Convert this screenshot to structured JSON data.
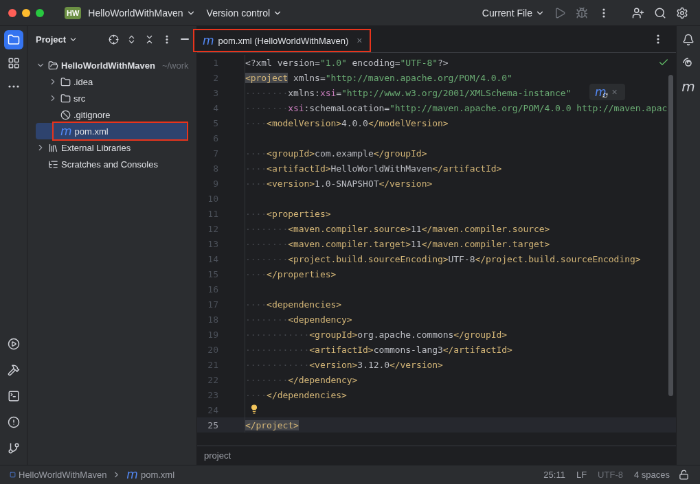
{
  "title_bar": {
    "project_badge": "HW",
    "project": "HelloWorldWithMaven",
    "vcs": "Version control",
    "run_config": "Current File",
    "actions": [
      {
        "kind": "run",
        "disabled": true
      },
      {
        "kind": "debug",
        "disabled": true
      },
      {
        "kind": "more",
        "disabled": false
      },
      {
        "kind": "add-user",
        "disabled": false
      },
      {
        "kind": "search",
        "disabled": false
      },
      {
        "kind": "settings",
        "disabled": false
      }
    ]
  },
  "left_strip": {
    "top": [
      {
        "kind": "project",
        "selected": true
      },
      {
        "kind": "structure",
        "selected": false
      },
      {
        "kind": "more",
        "selected": false
      }
    ],
    "bottom": [
      {
        "kind": "run",
        "selected": false
      },
      {
        "kind": "build",
        "selected": false
      },
      {
        "kind": "terminal",
        "selected": false
      },
      {
        "kind": "problems",
        "selected": false
      },
      {
        "kind": "git",
        "selected": false
      }
    ]
  },
  "project_panel": {
    "title": "Project",
    "tree": [
      {
        "label": "HelloWorldWithMaven",
        "kind": "module",
        "hint": "~/work",
        "bold": true,
        "expanded": true,
        "selected": false,
        "highlighted": false,
        "children": [
          {
            "label": ".idea",
            "kind": "folder",
            "expanded": false,
            "selected": false,
            "highlighted": false
          },
          {
            "label": "src",
            "kind": "folder",
            "expanded": false,
            "selected": false,
            "highlighted": false
          },
          {
            "label": ".gitignore",
            "kind": "ignore",
            "selected": false,
            "highlighted": false
          },
          {
            "label": "pom.xml",
            "kind": "maven",
            "icon": "m",
            "selected": true,
            "highlighted": true
          }
        ]
      },
      {
        "label": "External Libraries",
        "kind": "library",
        "expanded": false,
        "selected": false,
        "highlighted": false
      },
      {
        "label": "Scratches and Consoles",
        "kind": "scratches",
        "selected": false,
        "highlighted": false
      }
    ]
  },
  "editor": {
    "tabs": [
      {
        "icon": "m",
        "label": "pom.xml (HelloWorldWithMaven)",
        "close": "×",
        "selected": true,
        "highlighted": true
      }
    ],
    "popup": {
      "icon": "m",
      "close": "×"
    },
    "lines": [
      {
        "number": "1",
        "current": false,
        "tokens": [
          {
            "kind": "plain",
            "text": "<?xml version="
          },
          {
            "kind": "str",
            "text": "\"1.0\""
          },
          {
            "kind": "plain",
            "text": " encoding="
          },
          {
            "kind": "str",
            "text": "\"UTF-8\""
          },
          {
            "kind": "plain",
            "text": "?>"
          }
        ]
      },
      {
        "number": "2",
        "current": false,
        "tokens": [
          {
            "kind": "tag",
            "text": "<project",
            "match": true
          },
          {
            "kind": "attr",
            "text": " xmlns="
          },
          {
            "kind": "str",
            "text": "\"http://maven.apache.org/POM/4.0.0\""
          }
        ]
      },
      {
        "number": "3",
        "current": false,
        "tokens": [
          {
            "kind": "ws",
            "text": "········"
          },
          {
            "kind": "attr",
            "text": "xmlns:"
          },
          {
            "kind": "ns",
            "text": "xsi"
          },
          {
            "kind": "attr",
            "text": "="
          },
          {
            "kind": "str",
            "text": "\"http://www.w3.org/2001/XMLSchema-instance\""
          }
        ]
      },
      {
        "number": "4",
        "current": false,
        "tokens": [
          {
            "kind": "ws",
            "text": "········"
          },
          {
            "kind": "ns",
            "text": "xsi"
          },
          {
            "kind": "attr",
            "text": ":schemaLocation="
          },
          {
            "kind": "str",
            "text": "\"http://maven.apache.org/POM/4.0.0 http://maven.apac"
          }
        ]
      },
      {
        "number": "5",
        "current": false,
        "tokens": [
          {
            "kind": "ws",
            "text": "····"
          },
          {
            "kind": "tag",
            "text": "<modelVersion>"
          },
          {
            "kind": "text",
            "text": "4.0.0"
          },
          {
            "kind": "tag",
            "text": "</modelVersion>"
          }
        ]
      },
      {
        "number": "6",
        "current": false
      },
      {
        "number": "7",
        "current": false,
        "tokens": [
          {
            "kind": "ws",
            "text": "····"
          },
          {
            "kind": "tag",
            "text": "<groupId>"
          },
          {
            "kind": "text",
            "text": "com.example"
          },
          {
            "kind": "tag",
            "text": "</groupId>"
          }
        ]
      },
      {
        "number": "8",
        "current": false,
        "tokens": [
          {
            "kind": "ws",
            "text": "····"
          },
          {
            "kind": "tag",
            "text": "<artifactId>"
          },
          {
            "kind": "text",
            "text": "HelloWorldWithMaven"
          },
          {
            "kind": "tag",
            "text": "</artifactId>"
          }
        ]
      },
      {
        "number": "9",
        "current": false,
        "tokens": [
          {
            "kind": "ws",
            "text": "····"
          },
          {
            "kind": "tag",
            "text": "<version>"
          },
          {
            "kind": "text",
            "text": "1.0-SNAPSHOT"
          },
          {
            "kind": "tag",
            "text": "</version>"
          }
        ]
      },
      {
        "number": "10",
        "current": false
      },
      {
        "number": "11",
        "current": false,
        "tokens": [
          {
            "kind": "ws",
            "text": "····"
          },
          {
            "kind": "tag",
            "text": "<properties>"
          }
        ]
      },
      {
        "number": "12",
        "current": false,
        "tokens": [
          {
            "kind": "ws",
            "text": "········"
          },
          {
            "kind": "tag",
            "text": "<maven.compiler.source>"
          },
          {
            "kind": "text",
            "text": "11"
          },
          {
            "kind": "tag",
            "text": "</maven.compiler.source>"
          }
        ]
      },
      {
        "number": "13",
        "current": false,
        "tokens": [
          {
            "kind": "ws",
            "text": "········"
          },
          {
            "kind": "tag",
            "text": "<maven.compiler.target>"
          },
          {
            "kind": "text",
            "text": "11"
          },
          {
            "kind": "tag",
            "text": "</maven.compiler.target>"
          }
        ]
      },
      {
        "number": "14",
        "current": false,
        "tokens": [
          {
            "kind": "ws",
            "text": "········"
          },
          {
            "kind": "tag",
            "text": "<project.build.sourceEncoding>"
          },
          {
            "kind": "text",
            "text": "UTF-8"
          },
          {
            "kind": "tag",
            "text": "</project.build.sourceEncoding>"
          }
        ]
      },
      {
        "number": "15",
        "current": false,
        "tokens": [
          {
            "kind": "ws",
            "text": "····"
          },
          {
            "kind": "tag",
            "text": "</properties>"
          }
        ]
      },
      {
        "number": "16",
        "current": false
      },
      {
        "number": "17",
        "current": false,
        "tokens": [
          {
            "kind": "ws",
            "text": "····"
          },
          {
            "kind": "tag",
            "text": "<dependencies>"
          }
        ]
      },
      {
        "number": "18",
        "current": false,
        "tokens": [
          {
            "kind": "ws",
            "text": "········"
          },
          {
            "kind": "tag",
            "text": "<dependency>"
          }
        ]
      },
      {
        "number": "19",
        "current": false,
        "tokens": [
          {
            "kind": "ws",
            "text": "············"
          },
          {
            "kind": "tag",
            "text": "<groupId>"
          },
          {
            "kind": "text",
            "text": "org.apache.commons"
          },
          {
            "kind": "tag",
            "text": "</groupId>"
          }
        ]
      },
      {
        "number": "20",
        "current": false,
        "tokens": [
          {
            "kind": "ws",
            "text": "············"
          },
          {
            "kind": "tag",
            "text": "<artifactId>"
          },
          {
            "kind": "text",
            "text": "commons-lang3"
          },
          {
            "kind": "tag",
            "text": "</artifactId>"
          }
        ]
      },
      {
        "number": "21",
        "current": false,
        "tokens": [
          {
            "kind": "ws",
            "text": "············"
          },
          {
            "kind": "tag",
            "text": "<version>"
          },
          {
            "kind": "text",
            "text": "3.12.0"
          },
          {
            "kind": "tag",
            "text": "</version>"
          }
        ]
      },
      {
        "number": "22",
        "current": false,
        "tokens": [
          {
            "kind": "ws",
            "text": "········"
          },
          {
            "kind": "tag",
            "text": "</dependency>"
          }
        ]
      },
      {
        "number": "23",
        "current": false,
        "tokens": [
          {
            "kind": "ws",
            "text": "····"
          },
          {
            "kind": "tag",
            "text": "</dependencies>"
          }
        ]
      },
      {
        "number": "24",
        "current": false,
        "bulb": true
      },
      {
        "number": "25",
        "current": true,
        "tokens": [
          {
            "kind": "tag",
            "text": "</project>",
            "match": true
          }
        ]
      }
    ],
    "breadcrumb": "project"
  },
  "right_strip": [
    {
      "kind": "notifications"
    },
    {
      "kind": "ai"
    },
    {
      "kind": "maven",
      "text": "m"
    }
  ],
  "status_bar": {
    "path": [
      {
        "kind": "module",
        "label": "HelloWorldWithMaven"
      },
      {
        "kind": "maven",
        "icon": "m",
        "label": "pom.xml"
      }
    ],
    "items": [
      {
        "text": "25:11",
        "dim": false
      },
      {
        "text": "LF",
        "dim": false
      },
      {
        "text": "UTF-8",
        "dim": true
      },
      {
        "text": "4 spaces",
        "dim": false
      }
    ]
  }
}
